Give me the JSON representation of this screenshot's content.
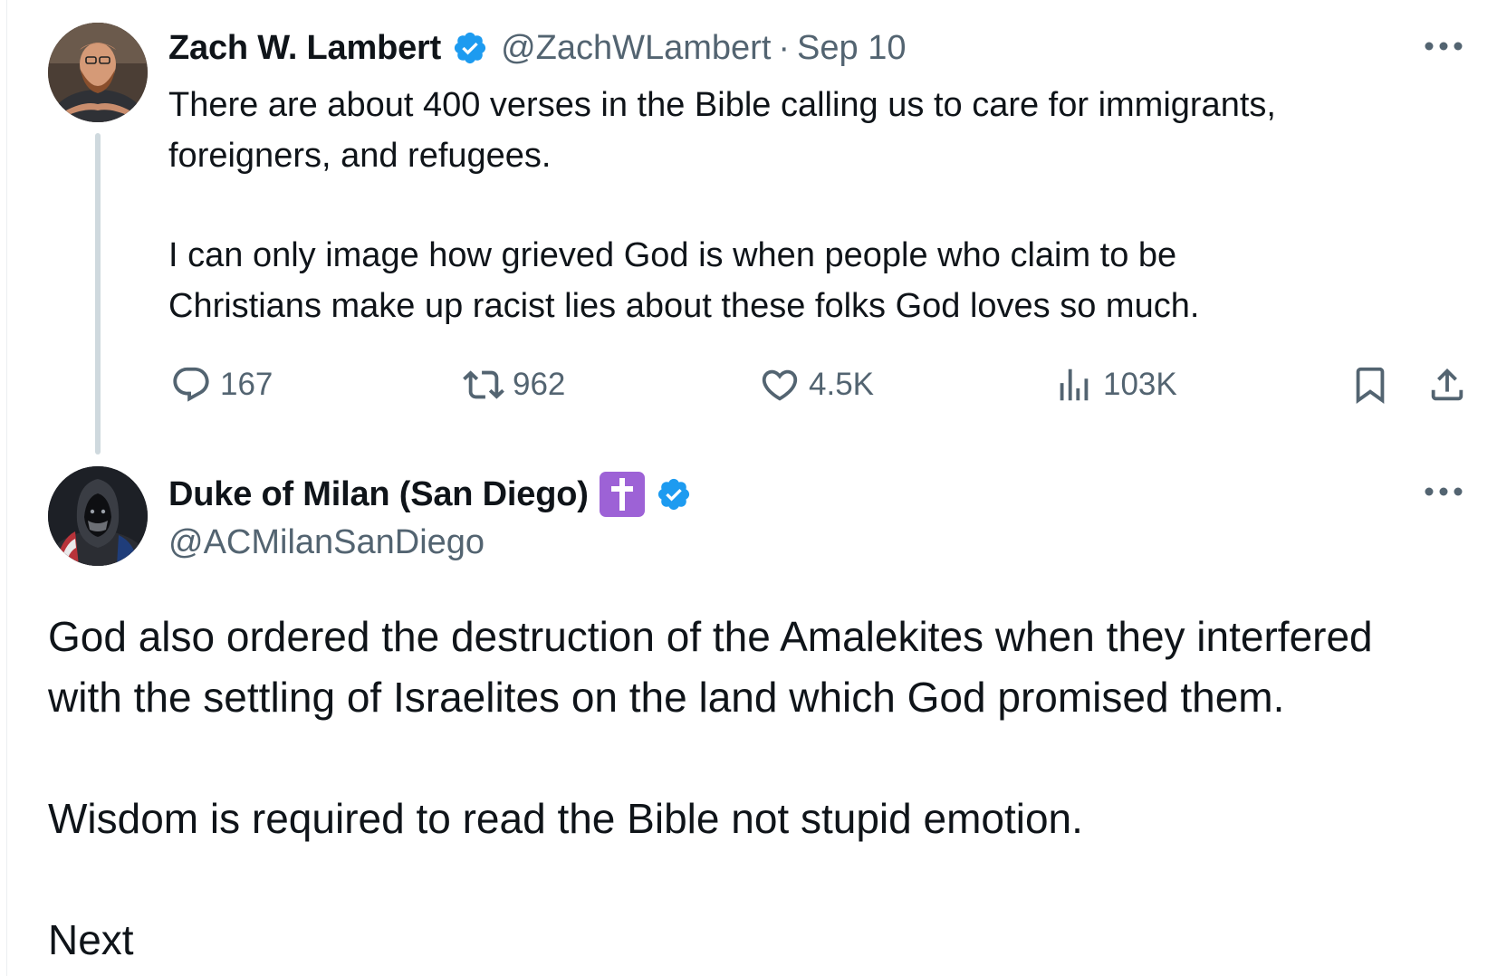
{
  "original_tweet": {
    "author_name": "Zach W. Lambert",
    "handle": "@ZachWLambert",
    "separator": "·",
    "date": "Sep 10",
    "text_lines": [
      "There are about 400 verses in the Bible calling us to care for immigrants,",
      "foreigners, and refugees."
    ],
    "text_lines_2": [
      "I can only image how grieved God is when people who claim to be",
      "Christians make up racist lies about these folks God loves so much."
    ],
    "stats": {
      "replies": "167",
      "retweets": "962",
      "likes": "4.5K",
      "views": "103K"
    }
  },
  "reply_tweet": {
    "author_name": "Duke of Milan (San Diego)",
    "handle": "@ACMilanSanDiego",
    "paragraph_1_lines": [
      "God also ordered the destruction of the Amalekites when they interfered",
      "with the settling of Israelites on the land which God promised them."
    ],
    "paragraph_2": "Wisdom is required to read the Bible not stupid emotion.",
    "paragraph_3": "Next"
  },
  "icons": [
    "verified-badge-icon",
    "more-icon",
    "reply-icon",
    "retweet-icon",
    "like-icon",
    "views-icon",
    "bookmark-icon",
    "share-icon",
    "latin-cross-emoji-icon"
  ],
  "colors": {
    "text": "#0f1419",
    "secondary": "#536471",
    "verified": "#1d9bf0",
    "thread_line": "#cfd9de",
    "cross_emoji_bg": "#9d62d6"
  }
}
